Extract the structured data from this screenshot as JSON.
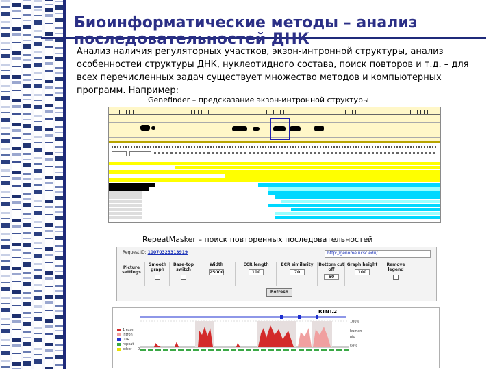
{
  "slide": {
    "title": "Биоинформатические методы – анализ последовательностей ДНК",
    "body": "Анализ наличия регуляторных участков, экзон-интронной структуры, анализ особенностей структуры ДНК, нуклеотидного состава, поиск повторов и т.д. – для всех перечисленных задач существует множество методов и компьютерных программ. Например:"
  },
  "genefinder": {
    "caption": "Genefinder – предсказание экзон-интронной структуры"
  },
  "repeatmasker": {
    "caption": "RepeatMasker – поиск повторенных последовательностей",
    "request_label": "Request ID:",
    "request_id": "10070323313919",
    "url": "http://genome.ucsc.edu/",
    "picture_settings": "Picture settings",
    "columns": [
      "Smooth graph",
      "Base-top switch",
      "Width",
      "ECR length",
      "ECR similarity",
      "Bottom cut off",
      "Graph height",
      "Remove legend"
    ],
    "width_value": "25000",
    "ecr_length_value": "100",
    "ecr_similarity_value": "70",
    "bottom_cutoff_value": "50",
    "graph_height_value": "100",
    "refresh_label": "Refresh"
  },
  "rtnt_chart": {
    "title": "RTNT.2",
    "axis_top": "100%",
    "axis_bottom": "50%",
    "axis_left": "0",
    "legend_items": [
      "1 exon",
      "intron",
      "UTR",
      "repeat",
      "other"
    ],
    "side_labels": [
      "100%",
      "human",
      "pig",
      "50%"
    ]
  },
  "colors": {
    "title": "#2b2f86",
    "accent_bar": "#1f2a7a"
  }
}
